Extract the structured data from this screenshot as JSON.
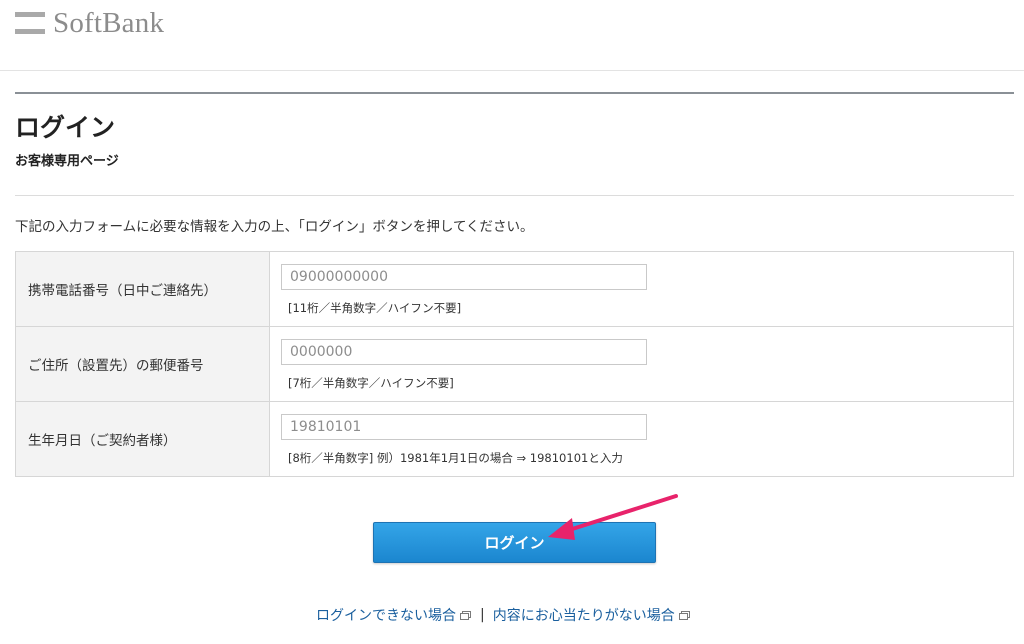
{
  "header": {
    "logo_text": "SoftBank"
  },
  "page": {
    "title": "ログイン",
    "subtitle": "お客様専用ページ",
    "instruction": "下記の入力フォームに必要な情報を入力の上、「ログイン」ボタンを押してください。"
  },
  "form": {
    "rows": [
      {
        "label": "携帯電話番号（日中ご連絡先）",
        "placeholder": "09000000000",
        "hint": "[11桁／半角数字／ハイフン不要]"
      },
      {
        "label": "ご住所（設置先）の郵便番号",
        "placeholder": "0000000",
        "hint": "[7桁／半角数字／ハイフン不要]"
      },
      {
        "label": "生年月日（ご契約者様）",
        "placeholder": "19810101",
        "hint": "[8桁／半角数字] 例）1981年1月1日の場合 ⇒ 19810101と入力"
      }
    ],
    "submit_label": "ログイン"
  },
  "footer": {
    "link_cannot_login": "ログインできない場合",
    "separator": "|",
    "link_not_recognized": "内容にお心当たりがない場合"
  },
  "colors": {
    "button": "#1b86cf",
    "arrow": "#e8236b",
    "link": "#1a5f9e"
  }
}
